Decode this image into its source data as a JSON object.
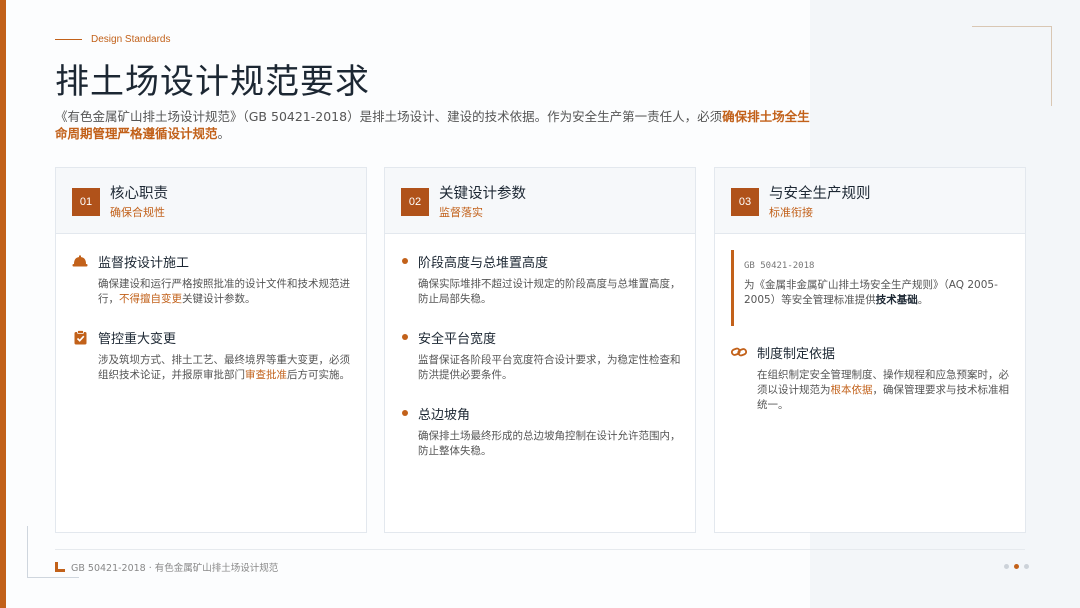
{
  "header": {
    "eyebrow": "Design Standards",
    "title": "排土场设计规范要求",
    "intro_plain": "《有色金属矿山排土场设计规范》（GB 50421-2018）是排土场设计、建设的技术依据。作为安全生产第一责任人，必须",
    "intro_highlight": "确保排土场全生命周期管理严格遵循设计规范",
    "intro_end": "。"
  },
  "cards": [
    {
      "num": "01",
      "title": "核心职责",
      "subtitle": "确保合规性",
      "items": [
        {
          "icon": "hard-hat-icon",
          "title": "监督按设计施工",
          "desc_a": "确保建设和运行严格按照批准的设计文件和技术规范进行，",
          "desc_hl": "不得擅自变更",
          "desc_b": "关键设计参数。"
        },
        {
          "icon": "clipboard-check-icon",
          "title": "管控重大变更",
          "desc_a": "涉及筑坝方式、排土工艺、最终境界等重大变更，必须组织技术论证，并报原审批部门",
          "desc_hl": "审查批准",
          "desc_b": "后方可实施。"
        }
      ]
    },
    {
      "num": "02",
      "title": "关键设计参数",
      "subtitle": "监督落实",
      "items": [
        {
          "title": "阶段高度与总堆置高度",
          "desc": "确保实际堆排不超过设计规定的阶段高度与总堆置高度，防止局部失稳。"
        },
        {
          "title": "安全平台宽度",
          "desc": "监督保证各阶段平台宽度符合设计要求，为稳定性检查和防洪提供必要条件。"
        },
        {
          "title": "总边坡角",
          "desc": "确保排土场最终形成的总边坡角控制在设计允许范围内，防止整体失稳。"
        }
      ]
    },
    {
      "num": "03",
      "title": "与安全生产规则",
      "subtitle": "标准衔接",
      "quote": {
        "tag": "GB 50421-2018",
        "text_a": "为《金属非金属矿山排土场安全生产规则》（AQ 2005-2005）等安全管理标准提供",
        "text_bold": "技术基础",
        "text_b": "。"
      },
      "item": {
        "icon": "link-icon",
        "title": "制度制定依据",
        "desc_a": "在组织制定安全管理制度、操作规程和应急预案时，必须以设计规范为",
        "desc_hl": "根本依据",
        "desc_b": "，确保管理要求与技术标准相统一。"
      }
    }
  ],
  "footer": {
    "text": "GB 50421-2018 · 有色金属矿山排土场设计规范",
    "pager_total": 3,
    "pager_active": 2
  },
  "colors": {
    "accent": "#c2611a",
    "title": "#1c2733",
    "body": "#555555"
  }
}
